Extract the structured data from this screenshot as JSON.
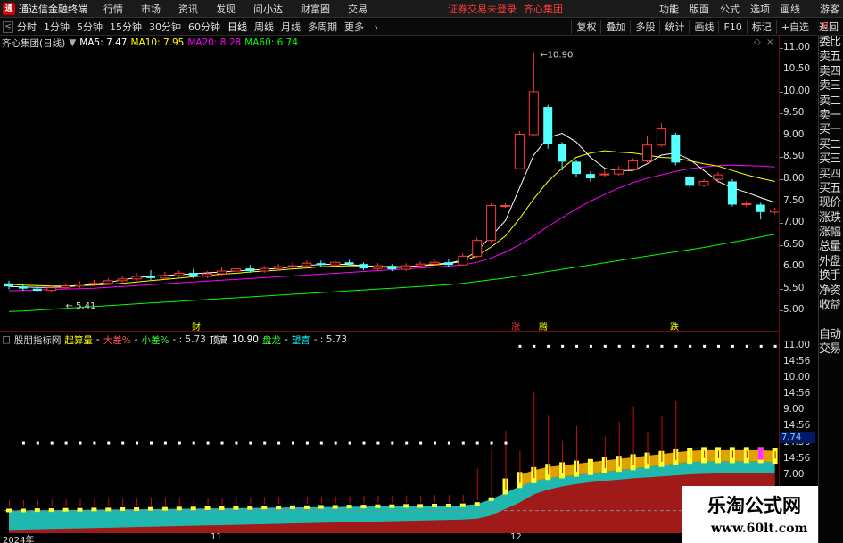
{
  "window": {
    "logo_char": "通",
    "app_title": "通达信金融终端",
    "notice": "证券交易未登录",
    "stock_name": "齐心集团"
  },
  "menu": [
    "行情",
    "市场",
    "资讯",
    "发现",
    "问小达",
    "财富圈",
    "交易"
  ],
  "right_menu": [
    "功能",
    "版面",
    "公式",
    "选项",
    "画线",
    "游客"
  ],
  "periods": [
    "分时",
    "1分钟",
    "5分钟",
    "15分钟",
    "30分钟",
    "60分钟",
    "日线",
    "周线",
    "月线",
    "多周期",
    "更多"
  ],
  "active_period": "日线",
  "tools": [
    "复权",
    "叠加",
    "多股",
    "统计",
    "画线",
    "F10",
    "标记",
    "+自选",
    "返回"
  ],
  "main_legend": {
    "stock": "齐心集团(日线)",
    "ma5": "MA5: 7.47",
    "ma10": "MA10: 7.95",
    "ma20": "MA20: 8.28",
    "ma60": "MA60: 6.74",
    "colors": {
      "ma5": "#ffffff",
      "ma10": "#ffff00",
      "ma20": "#ff00ff",
      "ma60": "#00ff00"
    }
  },
  "main_axis": [
    "11.00",
    "10.50",
    "10.00",
    "9.50",
    "9.00",
    "8.50",
    "8.00",
    "7.50",
    "7.00",
    "6.50",
    "6.00",
    "5.50",
    "5.00"
  ],
  "annotations": {
    "high": "10.90",
    "low": "5.41",
    "events": [
      "财",
      "涨",
      "腾",
      "跌"
    ]
  },
  "sub_legend": {
    "name": "股朋指标网",
    "q1_label": "起算量",
    "q1_val": "-",
    "q2_label": "大差%",
    "q2_val": "-",
    "q3_label": "小差%",
    "q3_val": "- : 5.73",
    "q4_label": "顶高",
    "q4_val": "10.90",
    "q5_label": "盘龙",
    "q5_val": "-",
    "q6_label": "望喜",
    "q6_val": "- : 5.73"
  },
  "sub_axis": [
    "11.00",
    "14:56",
    "10.00",
    "14:56",
    "9.00",
    "14:56",
    "14:56",
    "14:56",
    "7.00",
    "14:56",
    "14:56"
  ],
  "current_price_box": "7.74",
  "dates": [
    "2024年",
    "11",
    "12"
  ],
  "side_panel": [
    "委比",
    "卖五",
    "卖四",
    "卖三",
    "卖二",
    "卖一",
    "买一",
    "买二",
    "买三",
    "买四",
    "买五",
    "现价",
    "涨跌",
    "涨幅",
    "总量",
    "外盘",
    "换手",
    "净资",
    "收益",
    "",
    "自动",
    "交易"
  ],
  "side_mark": "R",
  "watermark": {
    "cn": "乐淘公式网",
    "url": "www.60lt.com"
  },
  "chart_data": {
    "type": "candlestick",
    "title": "齐心集团(日线)",
    "ylim": [
      4.8,
      11.2
    ],
    "note_values": {
      "high": 10.9,
      "low": 5.41
    },
    "candles": [
      [
        5.62,
        5.55,
        5.68,
        5.48
      ],
      [
        5.55,
        5.5,
        5.6,
        5.45
      ],
      [
        5.5,
        5.45,
        5.58,
        5.41
      ],
      [
        5.46,
        5.52,
        5.58,
        5.42
      ],
      [
        5.52,
        5.56,
        5.62,
        5.48
      ],
      [
        5.56,
        5.6,
        5.66,
        5.52
      ],
      [
        5.6,
        5.62,
        5.7,
        5.55
      ],
      [
        5.62,
        5.68,
        5.74,
        5.58
      ],
      [
        5.68,
        5.72,
        5.8,
        5.64
      ],
      [
        5.72,
        5.78,
        5.86,
        5.68
      ],
      [
        5.8,
        5.74,
        5.92,
        5.7
      ],
      [
        5.74,
        5.8,
        5.88,
        5.7
      ],
      [
        5.8,
        5.85,
        5.92,
        5.76
      ],
      [
        5.86,
        5.78,
        5.95,
        5.74
      ],
      [
        5.78,
        5.84,
        5.9,
        5.74
      ],
      [
        5.84,
        5.9,
        5.98,
        5.8
      ],
      [
        5.9,
        5.95,
        6.02,
        5.86
      ],
      [
        5.96,
        5.9,
        6.04,
        5.86
      ],
      [
        5.9,
        5.96,
        6.02,
        5.86
      ],
      [
        5.96,
        6.0,
        6.06,
        5.92
      ],
      [
        6.0,
        6.02,
        6.1,
        5.96
      ],
      [
        6.02,
        6.08,
        6.14,
        5.98
      ],
      [
        6.08,
        6.04,
        6.14,
        6.0
      ],
      [
        6.04,
        6.1,
        6.16,
        6.0
      ],
      [
        6.1,
        6.06,
        6.16,
        6.02
      ],
      [
        6.06,
        5.96,
        6.1,
        5.92
      ],
      [
        5.96,
        6.02,
        6.08,
        5.92
      ],
      [
        6.02,
        5.94,
        6.06,
        5.9
      ],
      [
        5.94,
        6.02,
        6.08,
        5.9
      ],
      [
        6.02,
        6.06,
        6.12,
        5.98
      ],
      [
        6.06,
        6.1,
        6.16,
        6.02
      ],
      [
        6.1,
        6.04,
        6.16,
        6.0
      ],
      [
        6.04,
        6.24,
        6.3,
        6.02
      ],
      [
        6.24,
        6.6,
        6.66,
        6.2
      ],
      [
        6.6,
        7.4,
        7.45,
        6.56
      ],
      [
        7.4,
        7.4,
        7.45,
        7.35
      ],
      [
        8.24,
        9.03,
        9.1,
        8.24
      ],
      [
        9.02,
        10.0,
        10.9,
        8.97
      ],
      [
        9.65,
        8.8,
        9.7,
        8.7
      ],
      [
        8.8,
        8.4,
        8.85,
        8.2
      ],
      [
        8.4,
        8.12,
        8.45,
        8.05
      ],
      [
        8.12,
        8.02,
        8.18,
        7.95
      ],
      [
        8.1,
        8.12,
        8.22,
        8.06
      ],
      [
        8.12,
        8.22,
        8.3,
        8.08
      ],
      [
        8.22,
        8.42,
        8.48,
        8.18
      ],
      [
        8.42,
        8.78,
        9.0,
        8.38
      ],
      [
        8.78,
        9.15,
        9.28,
        8.74
      ],
      [
        9.02,
        8.38,
        9.06,
        8.32
      ],
      [
        8.05,
        7.85,
        8.1,
        7.8
      ],
      [
        7.86,
        7.95,
        8.0,
        7.82
      ],
      [
        8.0,
        8.1,
        8.16,
        7.92
      ],
      [
        7.95,
        7.42,
        8.0,
        7.38
      ],
      [
        7.42,
        7.44,
        7.5,
        7.36
      ],
      [
        7.42,
        7.25,
        7.46,
        7.08
      ],
      [
        7.25,
        7.3,
        7.35,
        7.2
      ]
    ],
    "ma_series": {
      "ma5": [
        5.55,
        5.54,
        5.53,
        5.53,
        5.54,
        5.57,
        5.6,
        5.64,
        5.7,
        5.75,
        5.78,
        5.8,
        5.82,
        5.84,
        5.86,
        5.88,
        5.9,
        5.92,
        5.94,
        5.96,
        6.0,
        6.03,
        6.05,
        6.06,
        6.05,
        6.02,
        6.0,
        5.98,
        5.99,
        6.02,
        6.06,
        6.08,
        6.15,
        6.36,
        6.7,
        7.05,
        7.8,
        8.55,
        8.95,
        9.05,
        8.85,
        8.5,
        8.25,
        8.2,
        8.2,
        8.35,
        8.55,
        8.6,
        8.45,
        8.2,
        7.95,
        7.8,
        7.7,
        7.58,
        7.47
      ],
      "ma10": [
        5.6,
        5.58,
        5.57,
        5.56,
        5.56,
        5.57,
        5.58,
        5.6,
        5.62,
        5.65,
        5.68,
        5.71,
        5.74,
        5.77,
        5.8,
        5.83,
        5.85,
        5.88,
        5.9,
        5.92,
        5.95,
        5.97,
        6.0,
        6.01,
        6.02,
        6.02,
        6.01,
        6.0,
        6.0,
        6.02,
        6.04,
        6.07,
        6.12,
        6.25,
        6.45,
        6.7,
        7.1,
        7.55,
        7.95,
        8.25,
        8.5,
        8.6,
        8.65,
        8.62,
        8.6,
        8.55,
        8.5,
        8.48,
        8.42,
        8.35,
        8.3,
        8.2,
        8.1,
        8.02,
        7.95
      ],
      "ma20": [
        5.45,
        5.46,
        5.47,
        5.48,
        5.49,
        5.5,
        5.51,
        5.53,
        5.55,
        5.57,
        5.59,
        5.61,
        5.63,
        5.65,
        5.67,
        5.69,
        5.71,
        5.73,
        5.75,
        5.77,
        5.79,
        5.81,
        5.83,
        5.85,
        5.87,
        5.89,
        5.91,
        5.93,
        5.95,
        5.97,
        5.99,
        6.01,
        6.04,
        6.1,
        6.2,
        6.33,
        6.5,
        6.7,
        6.92,
        7.12,
        7.32,
        7.5,
        7.65,
        7.8,
        7.92,
        8.02,
        8.1,
        8.18,
        8.24,
        8.28,
        8.31,
        8.32,
        8.31,
        8.3,
        8.28
      ],
      "ma60": [
        4.98,
        4.99,
        5.01,
        5.03,
        5.05,
        5.07,
        5.09,
        5.11,
        5.13,
        5.15,
        5.17,
        5.19,
        5.21,
        5.23,
        5.25,
        5.27,
        5.29,
        5.31,
        5.33,
        5.35,
        5.37,
        5.39,
        5.41,
        5.43,
        5.45,
        5.47,
        5.49,
        5.51,
        5.53,
        5.55,
        5.57,
        5.59,
        5.62,
        5.66,
        5.7,
        5.74,
        5.79,
        5.84,
        5.89,
        5.94,
        5.99,
        6.04,
        6.09,
        6.14,
        6.19,
        6.24,
        6.29,
        6.34,
        6.39,
        6.44,
        6.5,
        6.56,
        6.62,
        6.68,
        6.74
      ]
    },
    "sub": {
      "type": "area",
      "band_upper": [
        5.9,
        5.9,
        5.91,
        5.91,
        5.92,
        5.92,
        5.93,
        5.93,
        5.94,
        5.94,
        5.95,
        5.95,
        5.96,
        5.96,
        5.97,
        5.97,
        5.98,
        5.98,
        5.99,
        5.99,
        6.0,
        6.0,
        6.01,
        6.01,
        6.02,
        6.02,
        6.03,
        6.03,
        6.04,
        6.04,
        6.05,
        6.05,
        6.06,
        6.1,
        6.25,
        6.45,
        6.65,
        6.8,
        6.9,
        6.95,
        7.0,
        7.05,
        7.1,
        7.15,
        7.2,
        7.25,
        7.3,
        7.35,
        7.4,
        7.42,
        7.42,
        7.42,
        7.42,
        7.42,
        7.4
      ],
      "band_lower": [
        5.3,
        5.31,
        5.32,
        5.33,
        5.34,
        5.35,
        5.36,
        5.37,
        5.38,
        5.39,
        5.4,
        5.41,
        5.42,
        5.43,
        5.44,
        5.45,
        5.46,
        5.47,
        5.48,
        5.49,
        5.5,
        5.51,
        5.52,
        5.53,
        5.54,
        5.55,
        5.56,
        5.57,
        5.58,
        5.59,
        5.6,
        5.61,
        5.62,
        5.65,
        5.75,
        5.95,
        6.15,
        6.4,
        6.55,
        6.65,
        6.72,
        6.78,
        6.82,
        6.86,
        6.9,
        6.93,
        6.96,
        6.99,
        7.02,
        7.04,
        7.05,
        7.06,
        7.06,
        7.07,
        7.07
      ],
      "dot_level": 8.0,
      "dot_level_high": 11.0
    }
  }
}
